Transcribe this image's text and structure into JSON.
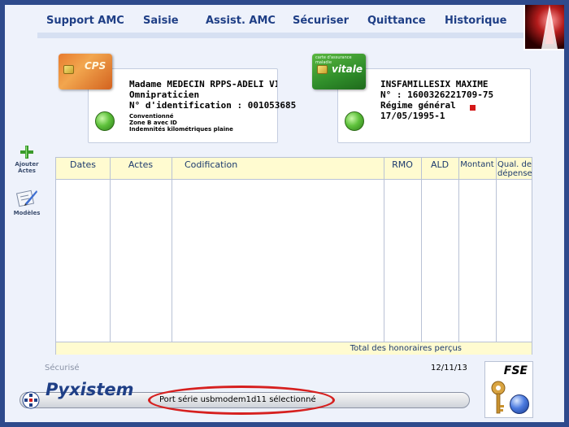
{
  "menu": {
    "items": [
      "Support AMC",
      "Saisie",
      "Assist. AMC",
      "Sécuriser",
      "Quittance",
      "Historique"
    ]
  },
  "cps": {
    "card_label": "CPS",
    "name": "Madame MEDECIN RPPS-ADELI VII",
    "specialty": "Omnipraticien",
    "id_line": "N° d'identification : 001053685",
    "line1": "Conventionné",
    "line2": "Zone B avec ID",
    "line3": "Indemnités kilométriques plaine"
  },
  "vitale": {
    "card_label": "vitale",
    "card_top": "carte d'assurance maladie",
    "name": "INSFAMILLESIX MAXIME",
    "number": "N° : 1600326221709-75",
    "regime": "Régime général",
    "birth": "17/05/1995-1"
  },
  "tools": {
    "add_acts_line1": "Ajouter",
    "add_acts_line2": "Actes",
    "models": "Modèles"
  },
  "table": {
    "columns": [
      "Dates",
      "Actes",
      "Codification",
      "RMO",
      "ALD",
      "Montant",
      "Qual. de dépense"
    ],
    "total_label": "Total des honoraires perçus"
  },
  "footer": {
    "secured": "Sécurisé",
    "date": "12/11/13",
    "brand": "Pyxistem",
    "status": "Port série usbmodem1d11 sélectionné",
    "fse": "FSE"
  },
  "colors": {
    "background": "#2e4a8c",
    "menu_text": "#1f3f86",
    "table_header": "#fffbd0",
    "highlight": "#d6201f"
  },
  "icons": {
    "add": "plus-icon",
    "models": "pen-paper-icon",
    "card_status": "green-dot-icon",
    "fse": "key-icon"
  }
}
